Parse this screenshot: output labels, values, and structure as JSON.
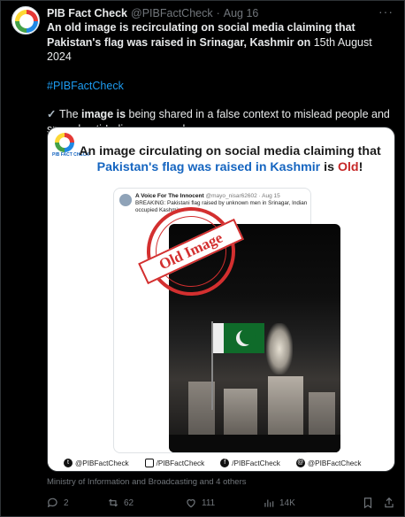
{
  "tweet": {
    "author_name": "PIB Fact Check",
    "handle": "@PIBFactCheck",
    "separator": "·",
    "date": "Aug 16",
    "more_icon": "more-dots-icon",
    "text": {
      "line1_a": "An old ",
      "line1_b": "image",
      "line1_c": " is recirculating on social media claiming that Pakistan's flag was raised in Srinagar, Kashmir ",
      "line1_d": "on",
      "line1_e": " 15th August 2024",
      "hashtag": "#PIBFactCheck",
      "line3_a": "The ",
      "line3_b": "image is",
      "line3_c": " being shared in a false context to mislead people and spread anti-India propaganda"
    }
  },
  "card": {
    "logo_text": "PIB FACT CHECK",
    "headline_a": "An image circulating on social media claiming that",
    "headline_b": "Pakistan's flag was raised in Kashmir",
    "headline_c": " is ",
    "headline_d": "Old",
    "headline_e": "!",
    "inner": {
      "author": "A Voice For The Innocent",
      "handle": "@mayo_nisar62602 · Aug 15",
      "text": "BREAKING: Pakistani flag raised by unknown men in Srinagar, Indian occupied Kashmir."
    },
    "stamp_text": "Old Image",
    "footer": [
      {
        "icon": "twitter-icon",
        "label": "@PIBFactCheck"
      },
      {
        "icon": "instagram-icon",
        "label": "/PIBFactCheck"
      },
      {
        "icon": "facebook-icon",
        "label": "/PIBFactCheck"
      },
      {
        "icon": "threads-icon",
        "label": "@PIBFactCheck"
      }
    ]
  },
  "caption": "Ministry of Information and Broadcasting and 4 others",
  "actions": {
    "replies": "2",
    "reposts": "62",
    "likes": "111",
    "views": "14K"
  },
  "colors": {
    "background": "#000000",
    "text": "#e7e9ea",
    "muted": "#71767b",
    "link": "#1d9bf0",
    "headline_blue": "#1565c0",
    "headline_red": "#c62828",
    "stamp_red": "#d32f2f"
  }
}
